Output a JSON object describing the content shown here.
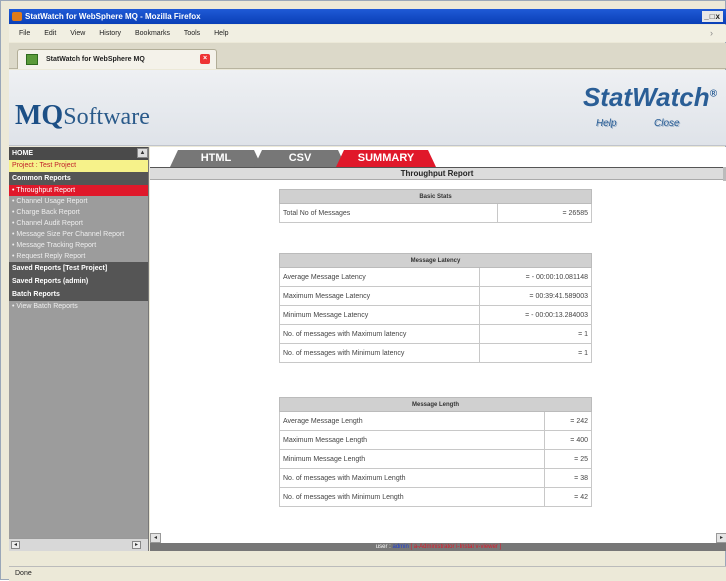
{
  "window": {
    "title": "StatWatch for WebSphere MQ - Mozilla Firefox",
    "controls": "_□x"
  },
  "menu": [
    "File",
    "Edit",
    "View",
    "History",
    "Bookmarks",
    "Tools",
    "Help"
  ],
  "browser_tab": {
    "label": "StatWatch for WebSphere MQ"
  },
  "header": {
    "logo_m": "MQ",
    "logo_rest": "Software",
    "brand": "StatWatch",
    "brand_mark": "®",
    "help": "Help",
    "close": "Close"
  },
  "sidebar": {
    "home": "HOME",
    "project": "Project : Test Project",
    "common_reports": "Common Reports",
    "items": [
      "• Throughput Report",
      "• Channel Usage Report",
      "• Charge Back Report",
      "• Channel Audit Report",
      "• Message Size Per Channel Report",
      "• Message Tracking Report",
      "• Request Reply Report"
    ],
    "saved_project": "Saved Reports [Test Project]",
    "saved_admin": "Saved Reports (admin)",
    "batch": "Batch Reports",
    "batch_item": "• View Batch Reports"
  },
  "report_tabs": [
    "HTML",
    "CSV",
    "SUMMARY"
  ],
  "report_title": "Throughput Report",
  "basic_stats": {
    "header": "Basic Stats",
    "rows": [
      {
        "label": "Total No of Messages",
        "value": "= 26585"
      }
    ]
  },
  "latency": {
    "header": "Message Latency",
    "rows": [
      {
        "label": "Average Message Latency",
        "value": "= - 00:00:10.081148"
      },
      {
        "label": "Maximum Message Latency",
        "value": "= 00:39:41.589003"
      },
      {
        "label": "Minimum Message Latency",
        "value": "= - 00:00:13.284003"
      },
      {
        "label": "No. of messages with Maximum latency",
        "value": "= 1"
      },
      {
        "label": "No. of messages with Minimum latency",
        "value": "= 1"
      }
    ]
  },
  "length": {
    "header": "Message Length",
    "rows": [
      {
        "label": "Average Message Length",
        "value": "= 242"
      },
      {
        "label": "Maximum Message Length",
        "value": "= 400"
      },
      {
        "label": "Minimum Message Length",
        "value": "= 25"
      },
      {
        "label": "No. of messages with Maximum Length",
        "value": "= 38"
      },
      {
        "label": "No. of messages with Minimum Length",
        "value": "= 42"
      }
    ]
  },
  "userbar": {
    "prefix": "user :",
    "user": "admin",
    "roles": "[ a-Administrator i-Instal v-viewer ]"
  },
  "status": "Done"
}
